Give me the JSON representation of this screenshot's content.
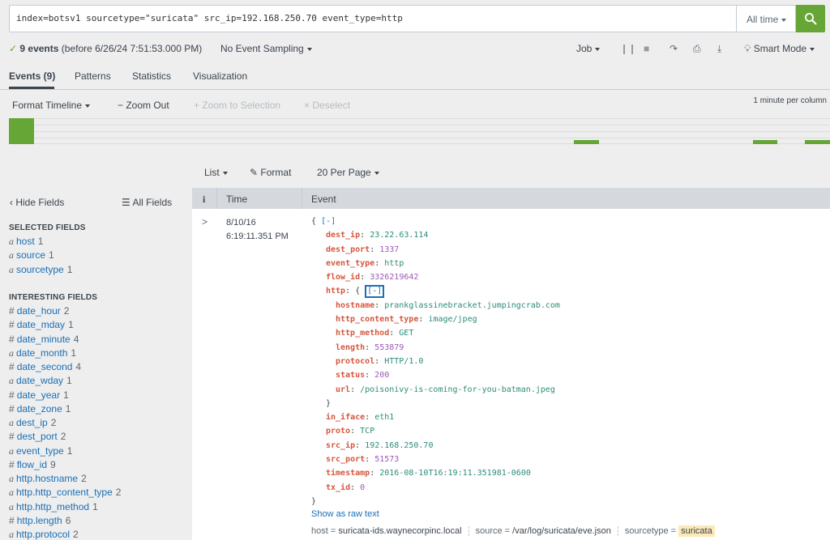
{
  "search": {
    "query": "index=botsv1 sourcetype=\"suricata\" src_ip=192.168.250.70 event_type=http",
    "time_range": "All time"
  },
  "status": {
    "check": "✓",
    "count": "9 events",
    "before": "(before 6/26/24 7:51:53.000 PM)",
    "sampling": "No Event Sampling",
    "job": "Job",
    "mode": "Smart Mode"
  },
  "tabs": [
    {
      "label": "Events (9)",
      "active": true
    },
    {
      "label": "Patterns",
      "active": false
    },
    {
      "label": "Statistics",
      "active": false
    },
    {
      "label": "Visualization",
      "active": false
    }
  ],
  "timeline_toolbar": {
    "format": "Format Timeline",
    "zoom_out": "− Zoom Out",
    "zoom_sel": "+ Zoom to Selection",
    "deselect": "× Deselect",
    "scale": "1 minute per column"
  },
  "timeline": {
    "bars": [
      {
        "start": 0.0,
        "width": 0.031,
        "height": 1.0
      },
      {
        "start": 0.688,
        "width": 0.031,
        "height": 0.17
      },
      {
        "start": 0.906,
        "width": 0.03,
        "height": 0.17
      },
      {
        "start": 0.969,
        "width": 0.031,
        "height": 0.17
      }
    ]
  },
  "results_toolbar": {
    "list": "List",
    "format": "Format",
    "per_page": "20 Per Page"
  },
  "sidebar": {
    "hide": "Hide Fields",
    "all": "All Fields",
    "selected_title": "SELECTED FIELDS",
    "interesting_title": "INTERESTING FIELDS",
    "selected": [
      {
        "type": "a",
        "name": "host",
        "count": "1"
      },
      {
        "type": "a",
        "name": "source",
        "count": "1"
      },
      {
        "type": "a",
        "name": "sourcetype",
        "count": "1"
      }
    ],
    "interesting": [
      {
        "type": "#",
        "name": "date_hour",
        "count": "2"
      },
      {
        "type": "#",
        "name": "date_mday",
        "count": "1"
      },
      {
        "type": "#",
        "name": "date_minute",
        "count": "4"
      },
      {
        "type": "a",
        "name": "date_month",
        "count": "1"
      },
      {
        "type": "#",
        "name": "date_second",
        "count": "4"
      },
      {
        "type": "a",
        "name": "date_wday",
        "count": "1"
      },
      {
        "type": "#",
        "name": "date_year",
        "count": "1"
      },
      {
        "type": "#",
        "name": "date_zone",
        "count": "1"
      },
      {
        "type": "a",
        "name": "dest_ip",
        "count": "2"
      },
      {
        "type": "#",
        "name": "dest_port",
        "count": "2"
      },
      {
        "type": "a",
        "name": "event_type",
        "count": "1"
      },
      {
        "type": "#",
        "name": "flow_id",
        "count": "9"
      },
      {
        "type": "a",
        "name": "http.hostname",
        "count": "2"
      },
      {
        "type": "a",
        "name": "http.http_content_type",
        "count": "2"
      },
      {
        "type": "a",
        "name": "http.http_method",
        "count": "1"
      },
      {
        "type": "#",
        "name": "http.length",
        "count": "6"
      },
      {
        "type": "a",
        "name": "http.protocol",
        "count": "2"
      }
    ]
  },
  "table": {
    "info_header": "i",
    "time_header": "Time",
    "event_header": "Event"
  },
  "event": {
    "date": "8/10/16",
    "time": "6:19:11.351 PM",
    "open": "{",
    "collapse": "[-]",
    "lines": [
      {
        "indent": 1,
        "key": "dest_ip",
        "value": "23.22.63.114",
        "vtype": "s"
      },
      {
        "indent": 1,
        "key": "dest_port",
        "value": "1337",
        "vtype": "n"
      },
      {
        "indent": 1,
        "key": "event_type",
        "value": "http",
        "vtype": "s"
      },
      {
        "indent": 1,
        "key": "flow_id",
        "value": "3326219642",
        "vtype": "n"
      },
      {
        "indent": 1,
        "key": "http",
        "value": "",
        "vtype": "obj"
      },
      {
        "indent": 2,
        "key": "hostname",
        "value": "prankglassinebracket.jumpingcrab.com",
        "vtype": "s"
      },
      {
        "indent": 2,
        "key": "http_content_type",
        "value": "image/jpeg",
        "vtype": "s"
      },
      {
        "indent": 2,
        "key": "http_method",
        "value": "GET",
        "vtype": "s"
      },
      {
        "indent": 2,
        "key": "length",
        "value": "553879",
        "vtype": "n"
      },
      {
        "indent": 2,
        "key": "protocol",
        "value": "HTTP/1.0",
        "vtype": "s"
      },
      {
        "indent": 2,
        "key": "status",
        "value": "200",
        "vtype": "n"
      },
      {
        "indent": 2,
        "key": "url",
        "value": "/poisonivy-is-coming-for-you-batman.jpeg",
        "vtype": "s"
      },
      {
        "indent": 1,
        "key": "",
        "value": "}",
        "vtype": "close"
      },
      {
        "indent": 1,
        "key": "in_iface",
        "value": "eth1",
        "vtype": "s"
      },
      {
        "indent": 1,
        "key": "proto",
        "value": "TCP",
        "vtype": "s"
      },
      {
        "indent": 1,
        "key": "src_ip",
        "value": "192.168.250.70",
        "vtype": "s"
      },
      {
        "indent": 1,
        "key": "src_port",
        "value": "51573",
        "vtype": "n"
      },
      {
        "indent": 1,
        "key": "timestamp",
        "value": "2016-08-10T16:19:11.351981-0600",
        "vtype": "s"
      },
      {
        "indent": 1,
        "key": "tx_id",
        "value": "0",
        "vtype": "n"
      },
      {
        "indent": 0,
        "key": "",
        "value": "}",
        "vtype": "close"
      }
    ],
    "raw_link": "Show as raw text",
    "meta": {
      "host_label": "host =",
      "host": "suricata-ids.waynecorpinc.local",
      "source_label": "source =",
      "source": "/var/log/suricata/eve.json",
      "sourcetype_label": "sourcetype =",
      "sourcetype": "suricata"
    }
  }
}
